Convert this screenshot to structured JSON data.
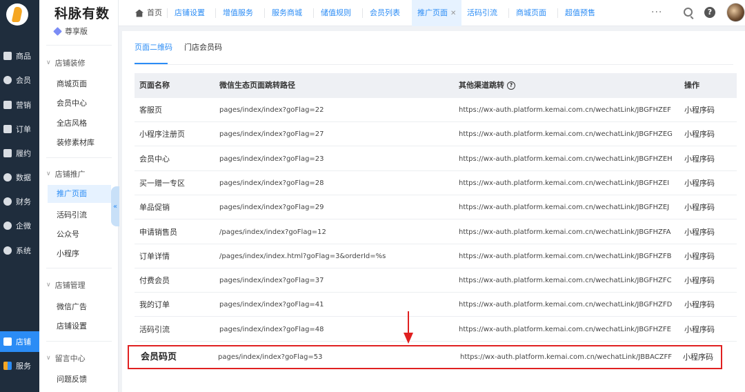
{
  "brand": {
    "name": "科脉有数",
    "edition": "尊享版"
  },
  "main_nav": [
    {
      "label": "商品",
      "icon": "goods-icon"
    },
    {
      "label": "会员",
      "icon": "member-icon"
    },
    {
      "label": "营销",
      "icon": "marketing-icon"
    },
    {
      "label": "订单",
      "icon": "order-icon"
    },
    {
      "label": "履约",
      "icon": "fulfillment-icon"
    },
    {
      "label": "数据",
      "icon": "data-icon"
    },
    {
      "label": "财务",
      "icon": "finance-icon"
    },
    {
      "label": "企微",
      "icon": "wecom-icon"
    },
    {
      "label": "系统",
      "icon": "system-icon"
    },
    {
      "label": "店铺",
      "icon": "store-icon",
      "active": true
    },
    {
      "label": "服务",
      "icon": "service-icon"
    }
  ],
  "sub_nav": {
    "decoration": {
      "title": "店铺装修",
      "items": [
        "商城页面",
        "会员中心",
        "全店风格",
        "装修素材库"
      ]
    },
    "promotion": {
      "title": "店铺推广",
      "items": [
        "推广页面",
        "活码引流",
        "公众号",
        "小程序"
      ],
      "active": "推广页面"
    },
    "management": {
      "title": "店铺管理",
      "items": [
        "微信广告",
        "店铺设置"
      ]
    },
    "messages": {
      "title": "留言中心",
      "items": [
        "问题反馈"
      ]
    }
  },
  "top_tabs": {
    "home": "首页",
    "tabs": [
      "店铺设置",
      "增值服务",
      "服务商城",
      "储值规则",
      "会员列表",
      "推广页面",
      "活码引流",
      "商城页面",
      "超值预售"
    ],
    "active": "推广页面",
    "more": "···"
  },
  "inner_tabs": [
    "页面二维码",
    "门店会员码"
  ],
  "table": {
    "headers": [
      "页面名称",
      "微信生态页面跳转路径",
      "其他渠道跳转",
      "操作"
    ],
    "help_icon": "?",
    "rows": [
      {
        "name": "客服页",
        "path": "pages/index/index?goFlag=22",
        "link": "https://wx-auth.platform.kemai.com.cn/wechatLink/JBGFHZEF",
        "op": "小程序码"
      },
      {
        "name": "小程序注册页",
        "path": "pages/index/index?goFlag=27",
        "link": "https://wx-auth.platform.kemai.com.cn/wechatLink/JBGFHZEG",
        "op": "小程序码"
      },
      {
        "name": "会员中心",
        "path": "pages/index/index?goFlag=23",
        "link": "https://wx-auth.platform.kemai.com.cn/wechatLink/JBGFHZEH",
        "op": "小程序码"
      },
      {
        "name": "买一赠一专区",
        "path": "pages/index/index?goFlag=28",
        "link": "https://wx-auth.platform.kemai.com.cn/wechatLink/JBGFHZEI",
        "op": "小程序码"
      },
      {
        "name": "单品促销",
        "path": "pages/index/index?goFlag=29",
        "link": "https://wx-auth.platform.kemai.com.cn/wechatLink/JBGFHZEJ",
        "op": "小程序码"
      },
      {
        "name": "申请销售员",
        "path": "/pages/index/index?goFlag=12",
        "link": "https://wx-auth.platform.kemai.com.cn/wechatLink/JBGFHZFA",
        "op": "小程序码"
      },
      {
        "name": "订单详情",
        "path": "/pages/index/index.html?goFlag=3&orderId=%s",
        "link": "https://wx-auth.platform.kemai.com.cn/wechatLink/JBGFHZFB",
        "op": "小程序码"
      },
      {
        "name": "付费会员",
        "path": "pages/index/index?goFlag=37",
        "link": "https://wx-auth.platform.kemai.com.cn/wechatLink/JBGFHZFC",
        "op": "小程序码"
      },
      {
        "name": "我的订单",
        "path": "pages/index/index?goFlag=41",
        "link": "https://wx-auth.platform.kemai.com.cn/wechatLink/JBGFHZFD",
        "op": "小程序码"
      },
      {
        "name": "活码引流",
        "path": "pages/index/index?goFlag=48",
        "link": "https://wx-auth.platform.kemai.com.cn/wechatLink/JBGFHZFE",
        "op": "小程序码"
      }
    ],
    "highlighted_row": {
      "name": "会员码页",
      "path": "pages/index/index?goFlag=53",
      "link": "https://wx-auth.platform.kemai.com.cn/wechatLink/JBBACZFF",
      "op": "小程序码"
    }
  },
  "colors": {
    "accent": "#2b8cf5",
    "sidebar": "#1f2d3d",
    "highlight": "#e02020"
  }
}
